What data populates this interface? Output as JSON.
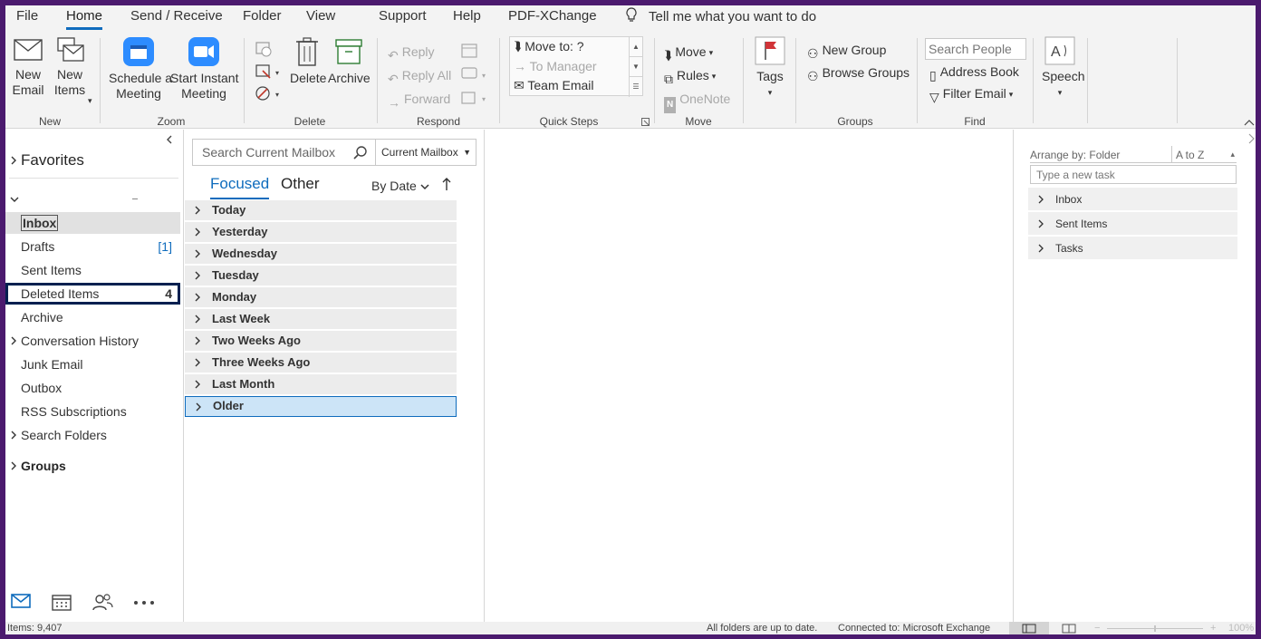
{
  "menu": {
    "file": "File",
    "home": "Home",
    "send_receive": "Send / Receive",
    "folder": "Folder",
    "view": "View",
    "support": "Support",
    "help": "Help",
    "pdfxchange": "PDF-XChange",
    "tellme": "Tell me what you want to do"
  },
  "ribbon": {
    "new_email": "New\nEmail",
    "new_items": "New\nItems",
    "schedule_meeting": "Schedule a\nMeeting",
    "start_instant_meeting": "Start Instant\nMeeting",
    "delete": "Delete",
    "archive": "Archive",
    "reply": "Reply",
    "reply_all": "Reply All",
    "forward": "Forward",
    "move_to": "Move to: ?",
    "to_manager": "To Manager",
    "team_email": "Team Email",
    "move": "Move",
    "rules": "Rules",
    "onenote": "OneNote",
    "tags": "Tags",
    "new_group": "New Group",
    "browse_groups": "Browse Groups",
    "search_people": "Search People",
    "address_book": "Address Book",
    "filter_email": "Filter Email",
    "speech": "Speech",
    "groups_labels": {
      "new": "New",
      "zoom": "Zoom",
      "delete": "Delete",
      "respond": "Respond",
      "quick_steps": "Quick Steps",
      "move": "Move",
      "groups": "Groups",
      "find": "Find"
    }
  },
  "folders": {
    "favorites": "Favorites",
    "items": [
      {
        "label": "Inbox",
        "count": ""
      },
      {
        "label": "Drafts",
        "count": "[1]"
      },
      {
        "label": "Sent Items",
        "count": ""
      },
      {
        "label": "Deleted Items",
        "count": "4"
      },
      {
        "label": "Archive",
        "count": ""
      },
      {
        "label": "Conversation History",
        "count": ""
      },
      {
        "label": "Junk Email",
        "count": ""
      },
      {
        "label": "Outbox",
        "count": ""
      },
      {
        "label": "RSS Subscriptions",
        "count": ""
      },
      {
        "label": "Search Folders",
        "count": ""
      }
    ],
    "groups": "Groups"
  },
  "message_list": {
    "search_placeholder": "Search Current Mailbox",
    "scope": "Current Mailbox",
    "tab_focused": "Focused",
    "tab_other": "Other",
    "sort": "By Date",
    "groups": [
      "Today",
      "Yesterday",
      "Wednesday",
      "Tuesday",
      "Monday",
      "Last Week",
      "Two Weeks Ago",
      "Three Weeks Ago",
      "Last Month",
      "Older"
    ]
  },
  "tasks": {
    "arrange": "Arrange by: Folder",
    "order": "A to Z",
    "new_task_placeholder": "Type a new task",
    "rows": [
      "Inbox",
      "Sent Items",
      "Tasks"
    ]
  },
  "status": {
    "items": "Items: 9,407",
    "uptodate": "All folders are up to date.",
    "connected": "Connected to: Microsoft Exchange",
    "zoom": "100%"
  },
  "colors": {
    "accent": "#0f6cbd",
    "frame": "#4b1a6e"
  }
}
